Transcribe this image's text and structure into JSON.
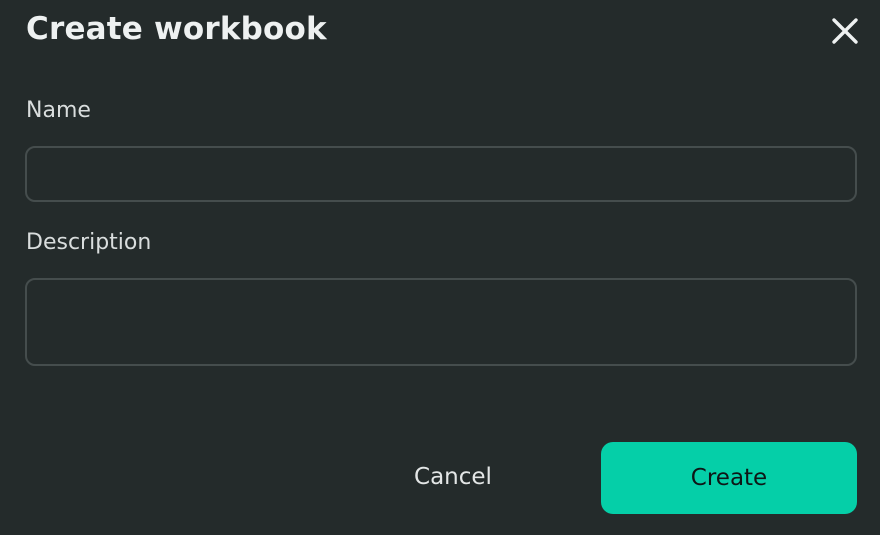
{
  "dialog": {
    "title": "Create workbook",
    "close_icon": "close-icon"
  },
  "form": {
    "name_label": "Name",
    "name_value": "",
    "description_label": "Description",
    "description_value": ""
  },
  "actions": {
    "cancel_label": "Cancel",
    "create_label": "Create"
  },
  "colors": {
    "background": "#242b2b",
    "accent": "#05cfa8",
    "input_border": "#454d4d",
    "text": "#e6e9e9"
  }
}
